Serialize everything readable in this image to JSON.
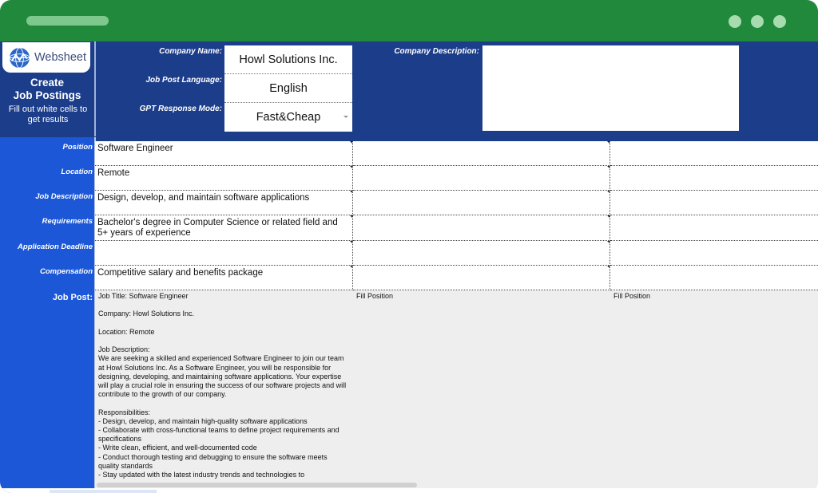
{
  "window": {
    "controls": [
      "window-dot",
      "window-dot",
      "window-dot"
    ]
  },
  "panel": {
    "logo_text": "Websheet",
    "title_line1": "Create",
    "title_line2": "Job Postings",
    "subtitle_line1": "Fill out white cells to",
    "subtitle_line2": "get results"
  },
  "settings": {
    "company_name_label": "Company Name:",
    "company_name_value": "Howl Solutions Inc.",
    "language_label": "Job Post Language:",
    "language_value": "English",
    "mode_label": "GPT Response Mode:",
    "mode_value": "Fast&Cheap",
    "company_description_label": "Company Description:",
    "company_description_value": ""
  },
  "rows": {
    "position": "Position",
    "location": "Location",
    "job_description": "Job Description",
    "requirements": "Requirements",
    "application_deadline": "Application Deadline",
    "compensation": "Compensation",
    "job_post": "Job Post:"
  },
  "columns": [
    {
      "position": "Software Engineer",
      "location": "Remote",
      "job_description": "Design, develop, and maintain software applications",
      "requirements": "Bachelor's degree in Computer Science or related field and 5+ years of experience",
      "application_deadline": "",
      "compensation": "Competitive salary and benefits package",
      "job_post": "Job Title: Software Engineer\n\nCompany: Howl Solutions Inc.\n\nLocation: Remote\n\nJob Description:\nWe are seeking a skilled and experienced Software Engineer to join our team at Howl Solutions Inc. As a Software Engineer, you will be responsible for designing, developing, and maintaining software applications. Your expertise will play a crucial role in ensuring the success of our software projects and will contribute to the growth of our company.\n\nResponsibilities:\n- Design, develop, and maintain high-quality software applications\n- Collaborate with cross-functional teams to define project requirements and specifications\n- Write clean, efficient, and well-documented code\n- Conduct thorough testing and debugging to ensure the software meets quality standards\n- Stay updated with the latest industry trends and technologies to"
    },
    {
      "position": "",
      "location": "",
      "job_description": "",
      "requirements": "",
      "application_deadline": "",
      "compensation": "",
      "job_post": "Fill Position"
    },
    {
      "position": "",
      "location": "",
      "job_description": "",
      "requirements": "",
      "application_deadline": "",
      "compensation": "",
      "job_post": "Fill Position"
    }
  ]
}
